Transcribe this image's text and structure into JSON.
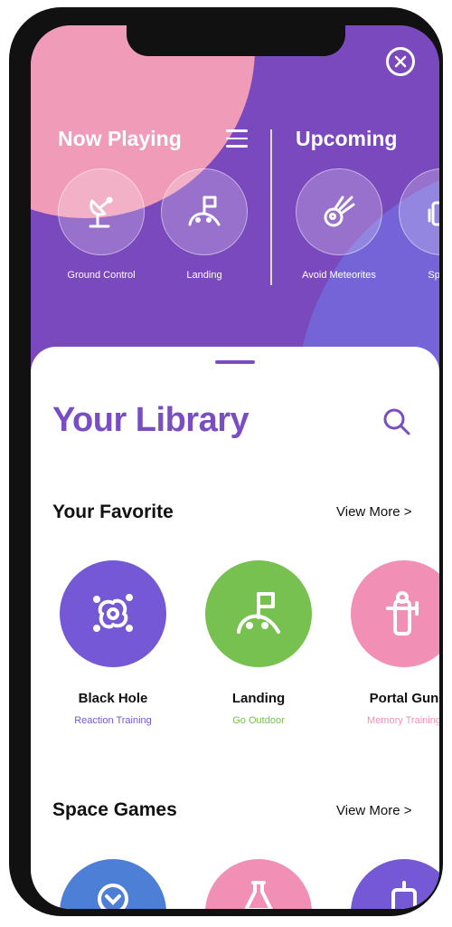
{
  "colors": {
    "accent": "#7a4dc4",
    "green": "#77c150",
    "pink": "#f28fb5",
    "purple": "#7458d6",
    "blue": "#4e7fd6"
  },
  "top": {
    "now_playing": "Now Playing",
    "upcoming": "Upcoming",
    "now_games": [
      {
        "label": "Ground Control",
        "icon": "satellite-dish-icon"
      },
      {
        "label": "Landing",
        "icon": "flag-planet-icon"
      }
    ],
    "upcoming_games": [
      {
        "label": "Avoid Meteorites",
        "icon": "meteor-icon"
      },
      {
        "label": "Space",
        "icon": "robot-icon"
      }
    ]
  },
  "library": {
    "title": "Your Library",
    "favorite_title": "Your Favorite",
    "view_more": "View More >",
    "favorites": [
      {
        "name": "Black Hole",
        "sub": "Reaction Training",
        "color": "#7458d6",
        "icon": "black-hole-icon"
      },
      {
        "name": "Landing",
        "sub": "Go Outdoor",
        "color": "#77c150",
        "icon": "flag-planet-icon"
      },
      {
        "name": "Portal Gun",
        "sub": "Memory Training",
        "color": "#f28fb5",
        "icon": "portal-gun-icon"
      }
    ],
    "space_title": "Space Games",
    "space_view_more": "View More >"
  }
}
